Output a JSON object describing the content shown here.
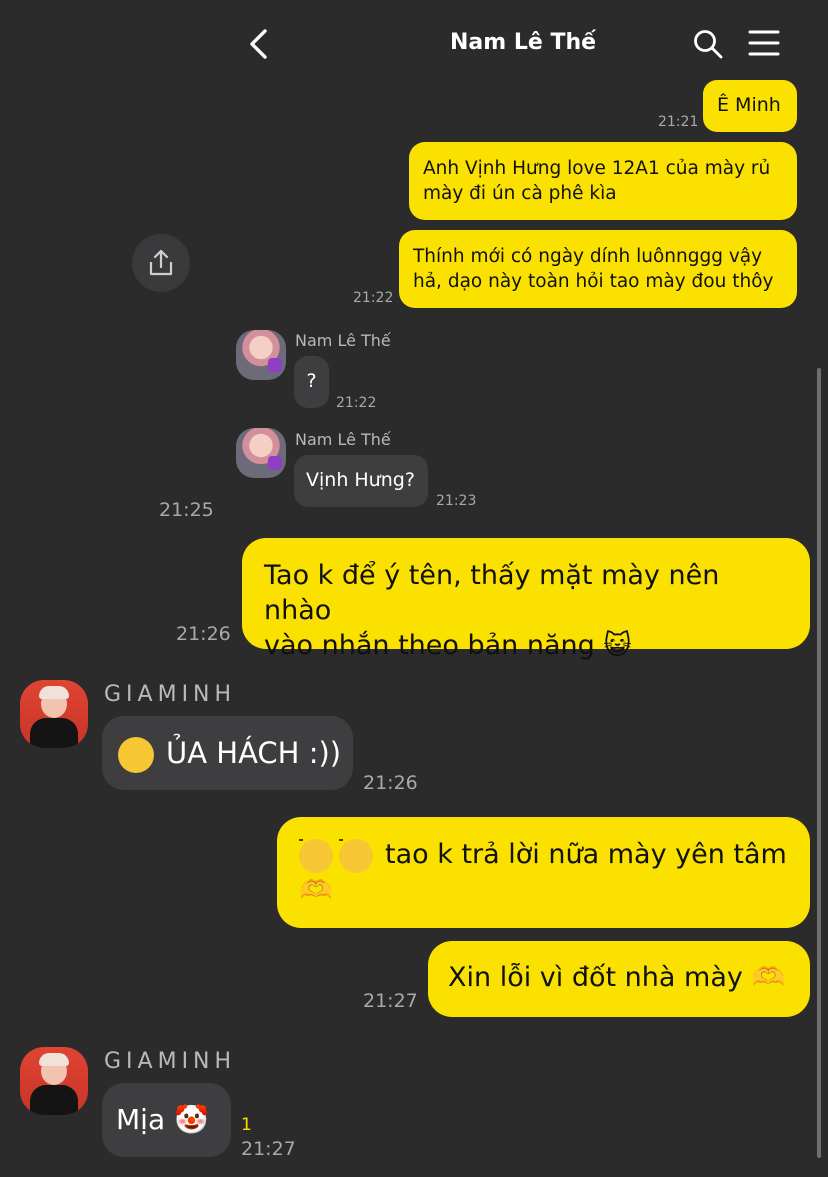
{
  "header": {
    "title": "Nam Lê Thế"
  },
  "icons": {
    "back": "chevron-left-icon",
    "search": "search-icon",
    "menu": "hamburger-menu-icon",
    "share": "share-icon"
  },
  "colors": {
    "background": "#2b2b2c",
    "my_bubble": "#fae100",
    "their_bubble": "#3e3e40",
    "unread": "#fae100"
  },
  "quoted": {
    "messages": [
      {
        "text": "Ê Minh",
        "time": "21:21"
      },
      {
        "text": "Anh Vịnh Hưng love 12A1 của mày rủ\nmày đi ún cà phê kìa"
      },
      {
        "text": "Thính mới có ngày dính luônnggg vậy\nhả, dạo này toàn hỏi tao mày đou thôy",
        "time": "21:22"
      },
      {
        "sender": "Nam Lê Thế",
        "text": "?",
        "time": "21:22"
      },
      {
        "sender": "Nam Lê Thế",
        "text": "Vịnh Hưng?",
        "time": "21:23"
      }
    ]
  },
  "messages": [
    {
      "time": "21:25"
    },
    {
      "text": "Tao k để ý tên, thấy mặt mày nên nhào\nvào nhắn theo bản năng 😺",
      "time": "21:26"
    },
    {
      "sender": "GIAMINH",
      "text": "ỦA HÁCH :))",
      "time": "21:26"
    },
    {
      "text": "tao k trả lời nữa mày yên tâm",
      "text_end": "🫶"
    },
    {
      "text": "Xin lỗi vì đốt nhà mày 🫶",
      "time": "21:27"
    },
    {
      "sender": "GIAMINH",
      "text": "Mịa 🤡",
      "unread": "1",
      "time": "21:27"
    }
  ]
}
